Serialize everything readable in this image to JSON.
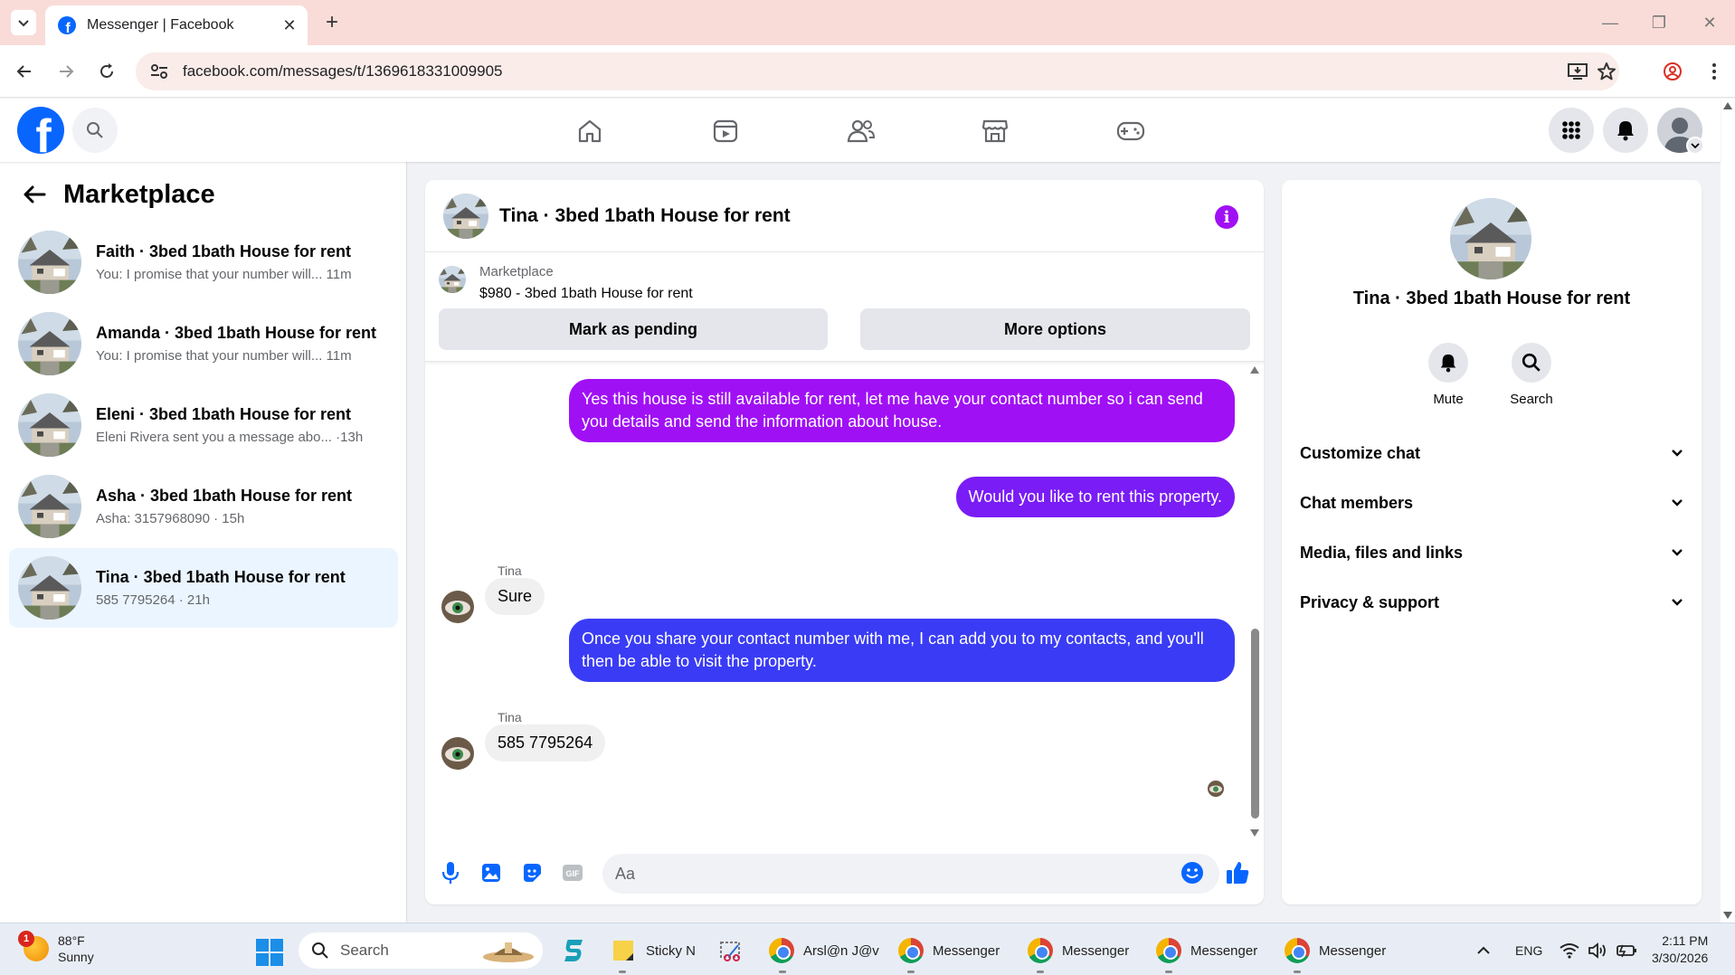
{
  "browser": {
    "tab_title": "Messenger | Facebook",
    "url": "facebook.com/messages/t/1369618331009905"
  },
  "sidebar": {
    "title": "Marketplace",
    "conversations": [
      {
        "name": "Faith · 3bed 1bath House for rent",
        "preview": "You: I promise that your number will... 11m",
        "active": false
      },
      {
        "name": "Amanda · 3bed 1bath House for rent",
        "preview": "You: I promise that your number will... 11m",
        "active": false
      },
      {
        "name": "Eleni · 3bed 1bath House for rent",
        "preview": "Eleni Rivera sent you a message abo... ·13h",
        "active": false
      },
      {
        "name": "Asha · 3bed 1bath House for rent",
        "preview": "Asha: 3157968090 · 15h",
        "active": false
      },
      {
        "name": "Tina · 3bed 1bath House for rent",
        "preview": "585 7795264 · 21h",
        "active": true
      }
    ]
  },
  "chat": {
    "title": "Tina · 3bed 1bath House for rent",
    "listing": {
      "label": "Marketplace",
      "price_title": "$980 - 3bed 1bath House for rent",
      "mark_pending": "Mark as pending",
      "more_options": "More options"
    },
    "messages": {
      "out1": "Yes this house is still available for rent, let me have your contact number so i can send you details and send the information about house.",
      "out2": "Would you like to rent this property.",
      "in1_sender": "Tina",
      "in1_text": "Sure",
      "out3": "Once you share your contact number with me, I can add you to my contacts, and you'll then be able to visit the property.",
      "in2_sender": "Tina",
      "in2_text": "585 7795264"
    },
    "composer_placeholder": "Aa"
  },
  "info_panel": {
    "title": "Tina · 3bed 1bath House for rent",
    "mute_label": "Mute",
    "search_label": "Search",
    "sections": [
      "Customize chat",
      "Chat members",
      "Media, files and links",
      "Privacy & support"
    ]
  },
  "taskbar": {
    "weather_badge": "1",
    "temperature": "88°F",
    "condition": "Sunny",
    "search_placeholder": "Search",
    "sticky": "Sticky N",
    "app1": "Arsl@n J@v",
    "app2": "Messenger",
    "app3": "Messenger",
    "app4": "Messenger",
    "app5": "Messenger",
    "lang": "ENG",
    "time": "2:11 PM",
    "date": "3/30/2026"
  },
  "colors": {
    "fb_blue": "#0866ff",
    "bubble_purple": "#a010f5",
    "bubble_violet": "#7a1cf5",
    "bubble_blue": "#3a3cf5",
    "active_conv": "#ebf5ff"
  }
}
